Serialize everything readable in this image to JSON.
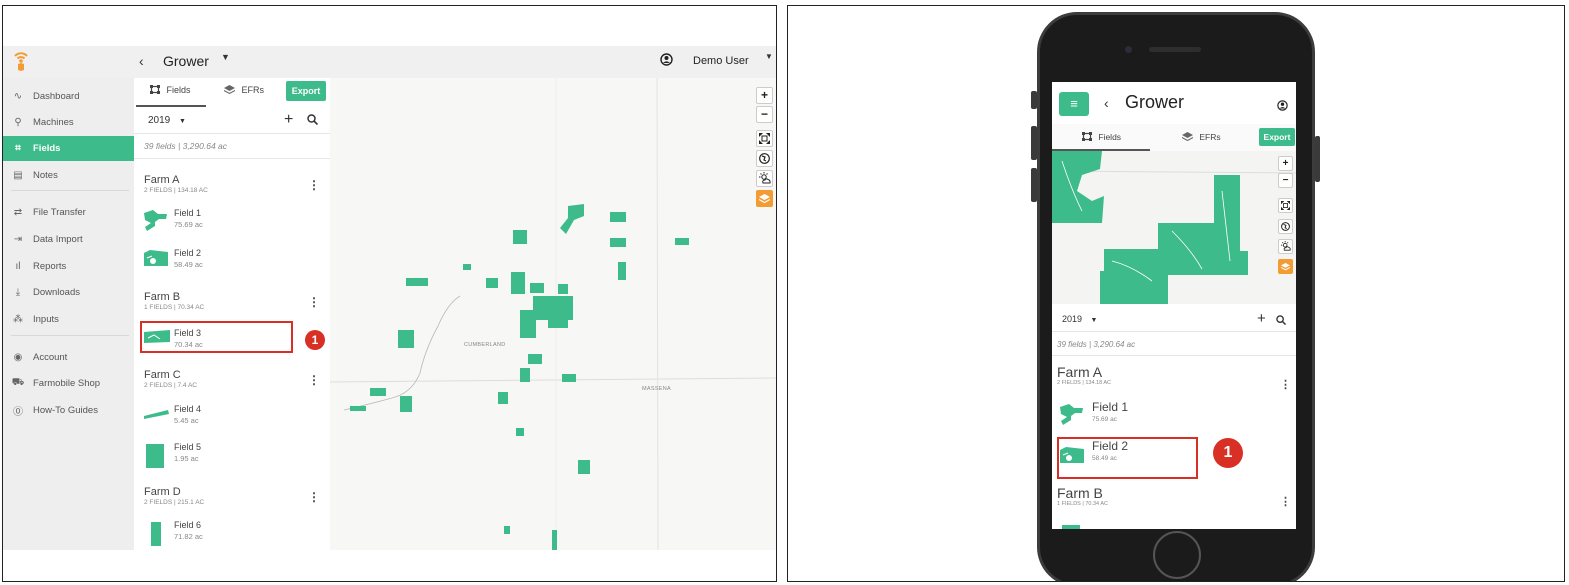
{
  "desktop": {
    "header": {
      "back_label": "‹",
      "grower_title": "Grower",
      "grower_caret": "▼",
      "user_name": "Demo User",
      "user_caret": "▼"
    },
    "sidebar": {
      "items": [
        {
          "icon": "∿",
          "label": "Dashboard"
        },
        {
          "icon": "⚲",
          "label": "Machines"
        },
        {
          "icon": "⌗",
          "label": "Fields",
          "active": true
        },
        {
          "icon": "▤",
          "label": "Notes"
        },
        {
          "icon": "⇄",
          "label": "File Transfer"
        },
        {
          "icon": "⇥",
          "label": "Data Import"
        },
        {
          "icon": "ıl",
          "label": "Reports"
        },
        {
          "icon": "⤓",
          "label": "Downloads"
        },
        {
          "icon": "⁂",
          "label": "Inputs"
        },
        {
          "icon": "◉",
          "label": "Account"
        },
        {
          "icon": "⛟",
          "label": "Farmobile Shop"
        },
        {
          "icon": "⓪",
          "label": "How-To Guides"
        }
      ]
    },
    "tabs": {
      "fields": "Fields",
      "efrs": "EFRs",
      "export": "Export"
    },
    "year": "2019",
    "year_caret": "▼",
    "add_label": "+",
    "summary": "39 fields | 3,290.64 ac",
    "farms": [
      {
        "name": "Farm A",
        "meta": "2 FIELDS | 134.18 AC",
        "fields": [
          {
            "name": "Field 1",
            "acres": "75.69 ac"
          },
          {
            "name": "Field 2",
            "acres": "58.49 ac"
          }
        ]
      },
      {
        "name": "Farm B",
        "meta": "1 FIELDS | 70.34 AC",
        "fields": [
          {
            "name": "Field 3",
            "acres": "70.34 ac"
          }
        ]
      },
      {
        "name": "Farm C",
        "meta": "2 FIELDS | 7.4 AC",
        "fields": [
          {
            "name": "Field 4",
            "acres": "5.45 ac"
          },
          {
            "name": "Field 5",
            "acres": "1.95 ac"
          }
        ]
      },
      {
        "name": "Farm D",
        "meta": "2 FIELDS | 215.1 AC",
        "fields": [
          {
            "name": "Field 6",
            "acres": "71.82 ac"
          }
        ]
      }
    ],
    "farm_menu": "⋮",
    "step_badge": "1",
    "map": {
      "labels": {
        "cumberland": "CUMBERLAND",
        "massena": "MASSENA"
      },
      "controls": {
        "zoom_in": "+",
        "zoom_out": "−"
      }
    }
  },
  "mobile": {
    "menu_icon": "≡",
    "back_label": "‹",
    "title": "Grower",
    "tabs": {
      "fields": "Fields",
      "efrs": "EFRs",
      "export": "Export"
    },
    "year": "2019",
    "year_caret": "▼",
    "add_label": "+",
    "summary": "39 fields | 3,290.64 ac",
    "farms": [
      {
        "name": "Farm A",
        "meta": "2 FIELDS | 134.18 AC",
        "fields": [
          {
            "name": "Field 1",
            "acres": "75.69 ac"
          },
          {
            "name": "Field 2",
            "acres": "58.49 ac"
          }
        ]
      },
      {
        "name": "Farm B",
        "meta": "1 FIELDS | 70.34 AC"
      }
    ],
    "farm_menu": "⋮",
    "step_badge": "1",
    "map": {
      "controls": {
        "zoom_in": "+",
        "zoom_out": "−"
      }
    }
  },
  "colors": {
    "accent": "#3dbb8a",
    "highlight": "#d93025",
    "logo": "#f39c33",
    "layers": "#f39c33"
  }
}
